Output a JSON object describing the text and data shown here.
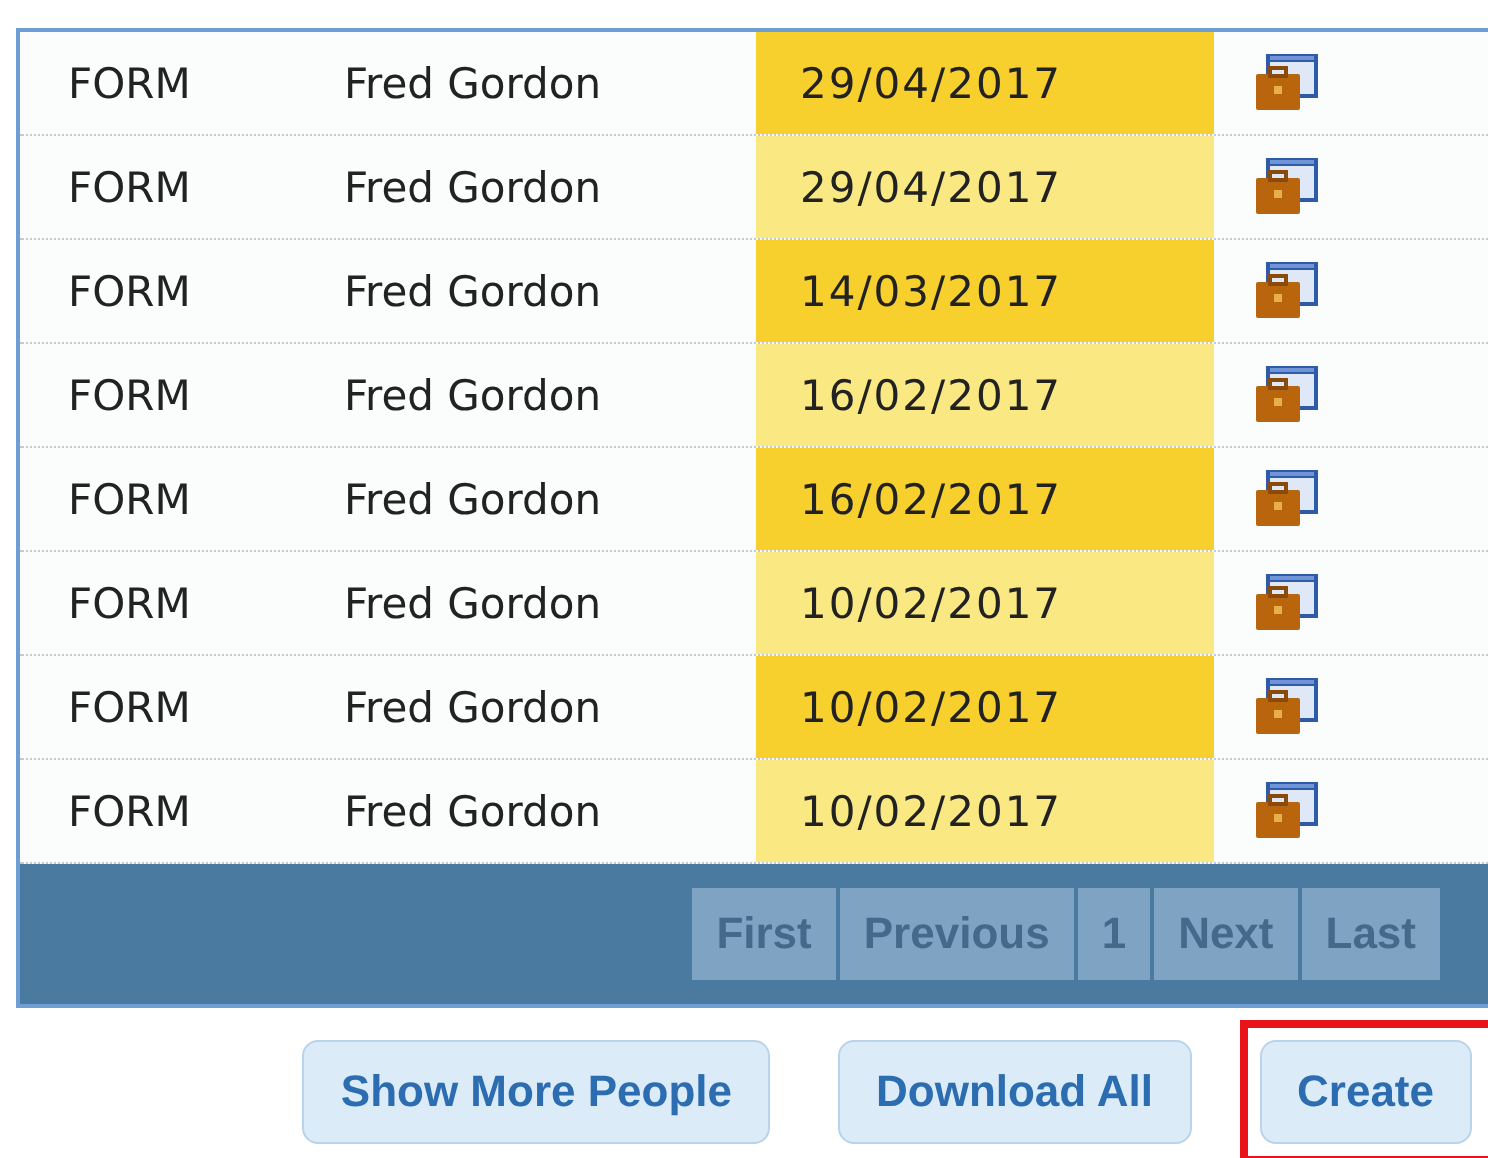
{
  "table": {
    "rows": [
      {
        "type": "FORM",
        "person": "Fred Gordon",
        "date": "29/04/2017"
      },
      {
        "type": "FORM",
        "person": "Fred Gordon",
        "date": "29/04/2017"
      },
      {
        "type": "FORM",
        "person": "Fred Gordon",
        "date": "14/03/2017"
      },
      {
        "type": "FORM",
        "person": "Fred Gordon",
        "date": "16/02/2017"
      },
      {
        "type": "FORM",
        "person": "Fred Gordon",
        "date": "16/02/2017"
      },
      {
        "type": "FORM",
        "person": "Fred Gordon",
        "date": "10/02/2017"
      },
      {
        "type": "FORM",
        "person": "Fred Gordon",
        "date": "10/02/2017"
      },
      {
        "type": "FORM",
        "person": "Fred Gordon",
        "date": "10/02/2017"
      }
    ]
  },
  "pager": [
    "First",
    "Previous",
    "1",
    "Next",
    "Last"
  ],
  "buttons": [
    {
      "label": "Show More People",
      "highlighted": false
    },
    {
      "label": "Download All",
      "highlighted": false
    },
    {
      "label": "Create",
      "highlighted": true
    }
  ]
}
